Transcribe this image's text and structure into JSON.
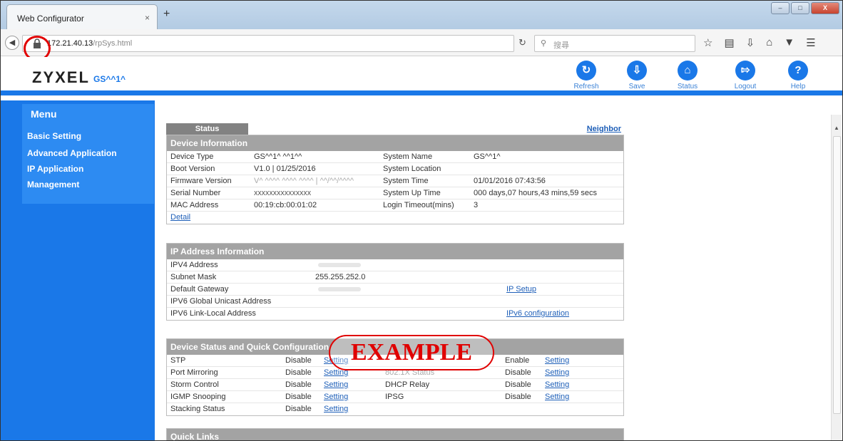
{
  "browser": {
    "tab_title": "Web Configurator",
    "tab_close": "×",
    "new_tab": "+",
    "url_host": "172.21.40.13",
    "url_path": "/rpSys.html",
    "search_placeholder": "搜尋",
    "window_controls": [
      "–",
      "□",
      "X"
    ]
  },
  "header": {
    "brand": "ZYXEL",
    "model": "GS^^1^",
    "buttons": [
      {
        "label": "Refresh",
        "icon": "refresh-icon"
      },
      {
        "label": "Save",
        "icon": "save-icon"
      },
      {
        "label": "Status",
        "icon": "status-icon"
      },
      {
        "label": "Logout",
        "icon": "logout-icon"
      },
      {
        "label": "Help",
        "icon": "help-icon"
      }
    ]
  },
  "sidebar": {
    "title": "Menu",
    "items": [
      "Basic Setting",
      "Advanced Application",
      "IP Application",
      "Management"
    ]
  },
  "status": {
    "tab_label": "Status",
    "neighbor_link": "Neighbor",
    "device_info": {
      "title": "Device Information",
      "device_type_label": "Device Type",
      "device_type": "GS^^1^ ^^1^^",
      "system_name_label": "System Name",
      "system_name": "GS^^1^",
      "boot_version_label": "Boot Version",
      "boot_version": "V1.0 | 01/25/2016",
      "system_location_label": "System Location",
      "firmware_version_label": "Firmware Version",
      "firmware_version": "V^ ^^^^ ^^^^ ^^^^ | ^^/^^/^^^^",
      "system_time_label": "System Time",
      "system_time": "01/01/2016 07:43:56",
      "serial_number_label": "Serial Number",
      "serial_number": "XXXXXXXXXXXXXXX",
      "system_up_time_label": "System Up Time",
      "system_up_time": "000 days,07 hours,43 mins,59 secs",
      "mac_address_label": "MAC Address",
      "mac_address": "00:19:cb:00:01:02",
      "login_timeout_label": "Login Timeout(mins)",
      "login_timeout": "3",
      "detail_link": "Detail"
    },
    "ip_info": {
      "title": "IP Address Information",
      "ipv4_label": "IPV4 Address",
      "subnet_label": "Subnet Mask",
      "subnet_value": "255.255.252.0",
      "gateway_label": "Default Gateway",
      "ipv6_global_label": "IPV6 Global Unicast Address",
      "ipv6_link_label": "IPV6 Link-Local Address",
      "ip_setup_link": "IP Setup",
      "ipv6_config_link": "IPv6 configuration"
    },
    "quick_config": {
      "title": "Device Status and Quick Configuration",
      "setting_label": "Setting",
      "left": [
        {
          "name": "STP",
          "state": "Disable"
        },
        {
          "name": "Port Mirroring",
          "state": "Disable"
        },
        {
          "name": "Storm Control",
          "state": "Disable"
        },
        {
          "name": "IGMP Snooping",
          "state": "Disable"
        },
        {
          "name": "Stacking Status",
          "state": "Disable"
        }
      ],
      "right": [
        {
          "name": "",
          "state": "Enable"
        },
        {
          "name": "802.1X Status",
          "state": "Disable"
        },
        {
          "name": "DHCP Relay",
          "state": "Disable"
        },
        {
          "name": "IPSG",
          "state": "Disable"
        }
      ]
    },
    "quick_links_title": "Quick Links"
  },
  "watermark": "EXAMPLE",
  "colors": {
    "brand_blue": "#1a78e8",
    "link": "#1e5fb8",
    "highlight_red": "#e00000"
  }
}
